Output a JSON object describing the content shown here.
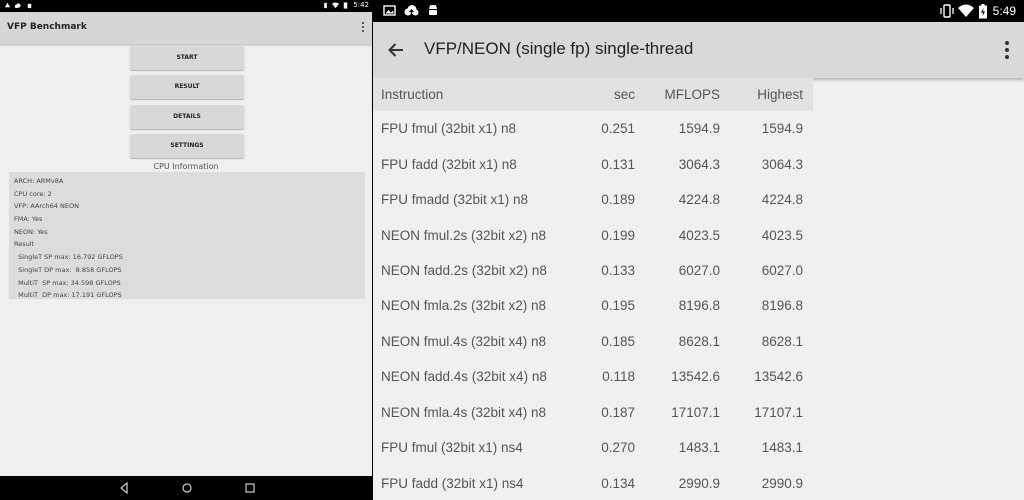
{
  "left_screen": {
    "status_bar": {
      "time": "5:42"
    },
    "app_title": "VFP Benchmark",
    "buttons": {
      "start": "START",
      "result": "RESULT",
      "details": "DETAILS",
      "settings": "SETTINGS"
    },
    "cpu_info_title": "CPU Information",
    "cpu_info_lines": [
      "ARCH: ARMv8A",
      "CPU core: 2",
      "VFP: AArch64 NEON",
      "FMA: Yes",
      "NEON: Yes",
      "Result",
      "  SingleT SP max: 16.792 GFLOPS",
      "  SingleT DP max:  8.858 GFLOPS",
      "  MultiT  SP max: 34.598 GFLOPS",
      "  MultiT  DP max: 17.191 GFLOPS"
    ]
  },
  "right_screen": {
    "status_bar": {
      "time": "5:49"
    },
    "title": "VFP/NEON (single fp) single-thread",
    "table": {
      "headers": [
        "Instruction",
        "sec",
        "MFLOPS",
        "Highest"
      ],
      "rows": [
        [
          "FPU fmul (32bit x1) n8",
          "0.251",
          "1594.9",
          "1594.9"
        ],
        [
          "FPU fadd (32bit x1) n8",
          "0.131",
          "3064.3",
          "3064.3"
        ],
        [
          "FPU fmadd (32bit x1) n8",
          "0.189",
          "4224.8",
          "4224.8"
        ],
        [
          "NEON fmul.2s (32bit x2) n8",
          "0.199",
          "4023.5",
          "4023.5"
        ],
        [
          "NEON fadd.2s (32bit x2) n8",
          "0.133",
          "6027.0",
          "6027.0"
        ],
        [
          "NEON fmla.2s (32bit x2) n8",
          "0.195",
          "8196.8",
          "8196.8"
        ],
        [
          "NEON fmul.4s (32bit x4) n8",
          "0.185",
          "8628.1",
          "8628.1"
        ],
        [
          "NEON fadd.4s (32bit x4) n8",
          "0.118",
          "13542.6",
          "13542.6"
        ],
        [
          "NEON fmla.4s (32bit x4) n8",
          "0.187",
          "17107.1",
          "17107.1"
        ],
        [
          "FPU fmul (32bit x1) ns4",
          "0.270",
          "1483.1",
          "1483.1"
        ],
        [
          "FPU fadd (32bit x1) ns4",
          "0.134",
          "2990.9",
          "2990.9"
        ]
      ]
    }
  },
  "colors": {
    "app_bar": "#d9d9d9",
    "background": "#f0f0f0",
    "status_bar": "#000000"
  }
}
